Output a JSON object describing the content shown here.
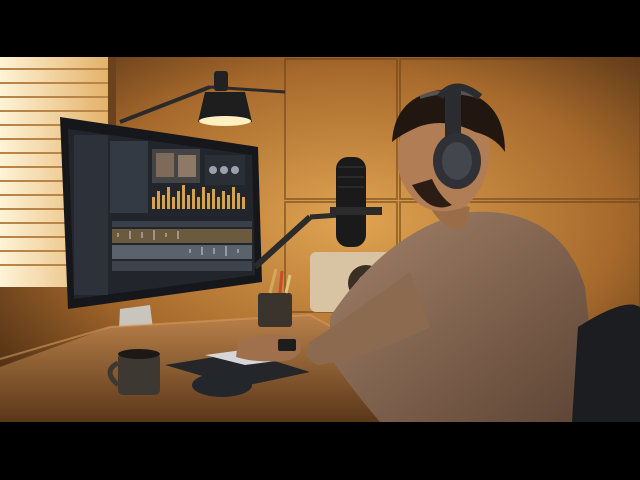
{
  "image": {
    "kind": "photograph",
    "subject": "man-editing-audio-at-desk",
    "letterbox": true
  },
  "palette": {
    "background_black": "#000000",
    "wall_warm": "#c98a3c",
    "wall_shadow": "#4a2a12",
    "desk_wood": "#9a6a3a",
    "sweater": "#8a6a4e",
    "screen_dark": "#22262c",
    "waveform_gold": "#d6a24a",
    "waveform_grey": "#9aa3ad"
  },
  "icons": [
    "desk-lamp-icon",
    "microphone-icon",
    "headphones-icon",
    "speaker-icon",
    "mouse-icon",
    "keyboard-icon",
    "mug-icon",
    "pencil-cup-icon",
    "window-blinds-icon"
  ]
}
